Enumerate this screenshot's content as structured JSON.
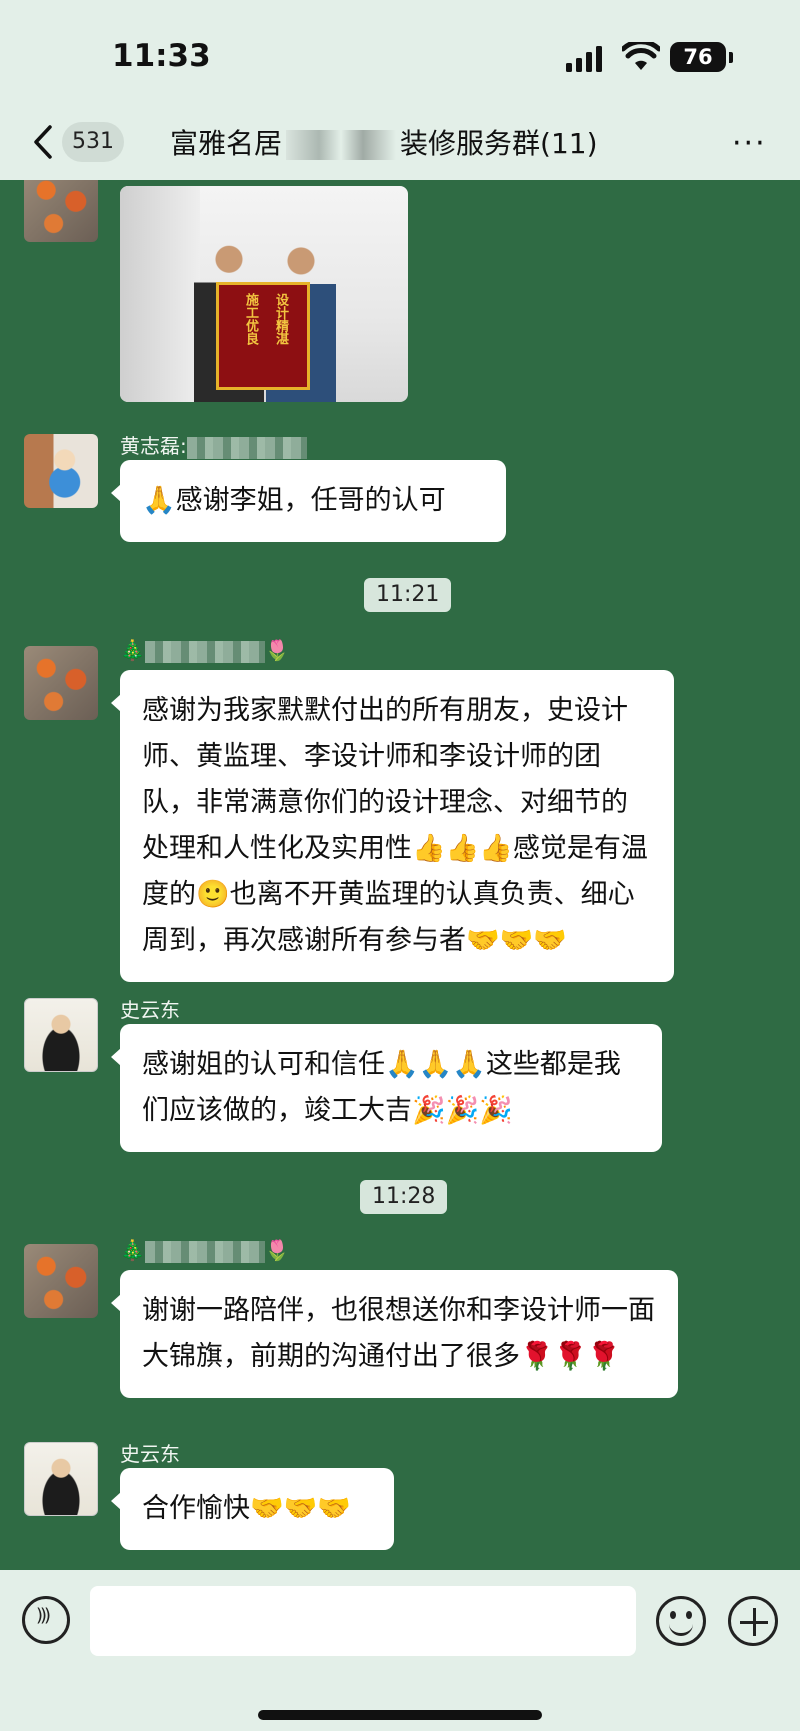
{
  "status_bar": {
    "time": "11:33",
    "battery": "76"
  },
  "nav": {
    "unread_count": "531",
    "title_prefix": "富雅名居",
    "title_suffix": "装修服务群(11)",
    "more": "···"
  },
  "messages": [
    {
      "sender": "黄志磊:",
      "text": "🙏感谢李姐，任哥的认可"
    },
    {
      "time": "11:21"
    },
    {
      "sender_prefix": "🎄",
      "sender_suffix": "🌷",
      "text": "感谢为我家默默付出的所有朋友，史设计师、黄监理、李设计师和李设计师的团队，非常满意你们的设计理念、对细节的处理和人性化及实用性👍👍👍感觉是有温度的🙂也离不开黄监理的认真负责、细心周到，再次感谢所有参与者🤝🤝🤝"
    },
    {
      "sender": "史云东",
      "text": "感谢姐的认可和信任🙏🙏🙏这些都是我们应该做的，竣工大吉🎉🎉🎉"
    },
    {
      "time": "11:28"
    },
    {
      "sender_prefix": "🎄",
      "sender_suffix": "🌷",
      "text": "谢谢一路陪伴，也很想送你和李设计师一面大锦旗，前期的沟通付出了很多🌹🌹🌹"
    },
    {
      "sender": "史云东",
      "text": "合作愉快🤝🤝🤝"
    }
  ],
  "photo_banner": {
    "line1": "设计精湛",
    "line2": "施工优良"
  }
}
